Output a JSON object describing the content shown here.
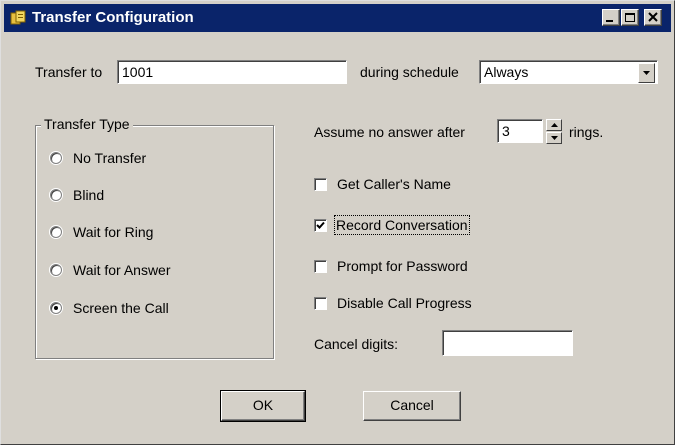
{
  "window": {
    "title": "Transfer Configuration",
    "colors": {
      "titlebar": "#0a246a",
      "face": "#d4d0c8"
    },
    "icons": [
      "app-icon",
      "minimize-icon",
      "maximize-icon",
      "close-icon"
    ]
  },
  "transfer_to": {
    "label": "Transfer to",
    "value": "1001"
  },
  "schedule": {
    "label": "during schedule",
    "value": "Always"
  },
  "transfer_type": {
    "title": "Transfer Type",
    "options": [
      {
        "label": "No Transfer",
        "selected": false
      },
      {
        "label": "Blind",
        "selected": false
      },
      {
        "label": "Wait for Ring",
        "selected": false
      },
      {
        "label": "Wait for Answer",
        "selected": false
      },
      {
        "label": "Screen the Call",
        "selected": true
      }
    ]
  },
  "no_answer": {
    "label_before": "Assume no answer after",
    "value": "3",
    "label_after": "rings."
  },
  "options": [
    {
      "label": "Get Caller's Name",
      "checked": false
    },
    {
      "label": "Record Conversation",
      "checked": true
    },
    {
      "label": "Prompt for Password",
      "checked": false
    },
    {
      "label": "Disable Call Progress",
      "checked": false
    }
  ],
  "cancel_digits": {
    "label": "Cancel digits:",
    "value": ""
  },
  "buttons": {
    "ok": "OK",
    "cancel": "Cancel"
  }
}
